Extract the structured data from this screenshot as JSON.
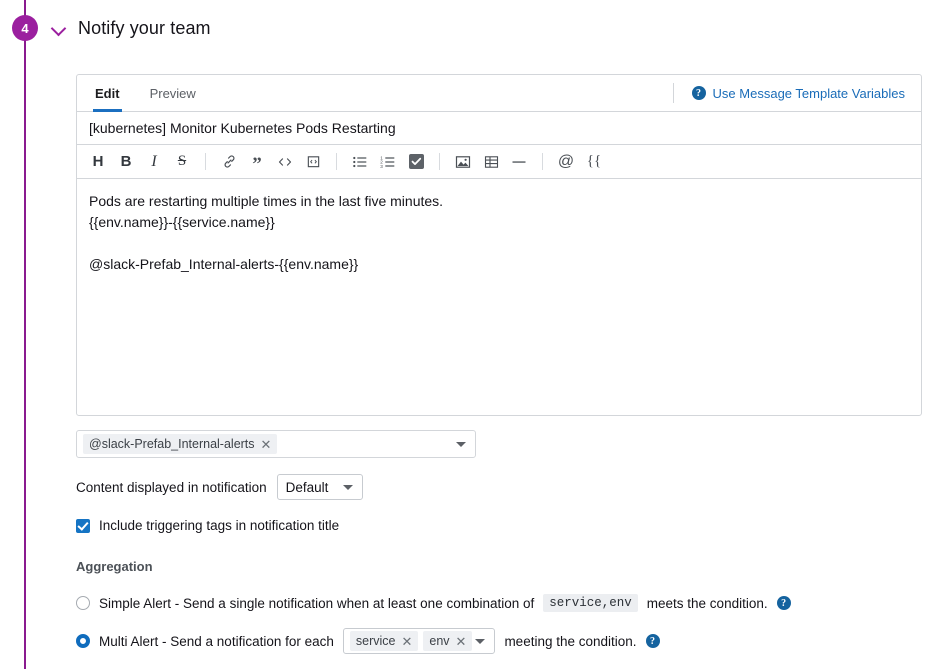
{
  "step": {
    "number": "4",
    "title": "Notify your team",
    "collapse_icon": "chevron-down-icon",
    "accent_color": "#9b1f9f"
  },
  "editor": {
    "tabs": [
      {
        "label": "Edit",
        "active": true
      },
      {
        "label": "Preview",
        "active": false
      }
    ],
    "template_vars_link": "Use Message Template Variables",
    "subject": "[kubernetes] Monitor Kubernetes Pods Restarting",
    "toolbar": [
      {
        "name": "heading-icon",
        "glyph": "H"
      },
      {
        "name": "bold-icon",
        "glyph": "B"
      },
      {
        "name": "italic-icon",
        "glyph": "I"
      },
      {
        "name": "strikethrough-icon",
        "glyph": "S"
      },
      {
        "name": "link-icon",
        "glyph": "link"
      },
      {
        "name": "quote-icon",
        "glyph": "”"
      },
      {
        "name": "code-icon",
        "glyph": "</>"
      },
      {
        "name": "code-block-icon",
        "glyph": "codeblock"
      },
      {
        "name": "bulleted-list-icon",
        "glyph": "ul"
      },
      {
        "name": "numbered-list-icon",
        "glyph": "ol"
      },
      {
        "name": "task-list-icon",
        "glyph": "checkbox"
      },
      {
        "name": "image-icon",
        "glyph": "image"
      },
      {
        "name": "table-icon",
        "glyph": "table"
      },
      {
        "name": "horizontal-rule-icon",
        "glyph": "—"
      },
      {
        "name": "mention-icon",
        "glyph": "@"
      },
      {
        "name": "variable-icon",
        "glyph": "{{"
      }
    ],
    "message_body": "Pods are restarting multiple times in the last five minutes.\n{{env.name}}-{{service.name}}\n\n@slack-Prefab_Internal-alerts-{{env.name}}",
    "active_tab_underline_color": "#1b6fc0",
    "link_color": "#1a6cb8"
  },
  "recipients": {
    "tokens": [
      "@slack-Prefab_Internal-alerts"
    ],
    "remove_label": "✕",
    "dropdown_icon": "chevron-down-icon"
  },
  "content_display": {
    "label": "Content displayed in notification",
    "value": "Default",
    "dropdown_icon": "chevron-down-icon"
  },
  "include_tags": {
    "label": "Include triggering tags in notification title",
    "checked": true
  },
  "aggregation": {
    "title": "Aggregation",
    "options": [
      {
        "id": "simple-alert",
        "selected": false,
        "text_before": "Simple Alert - Send a single notification when at least one combination of",
        "code_chip": "service,env",
        "text_after": "meets the condition.",
        "help_icon": "help-icon"
      },
      {
        "id": "multi-alert",
        "selected": true,
        "text_before": "Multi Alert - Send a notification for each",
        "tokens": [
          "service",
          "env"
        ],
        "text_after": "meeting the condition.",
        "help_icon": "help-icon"
      }
    ],
    "token_remove_label": "✕"
  }
}
